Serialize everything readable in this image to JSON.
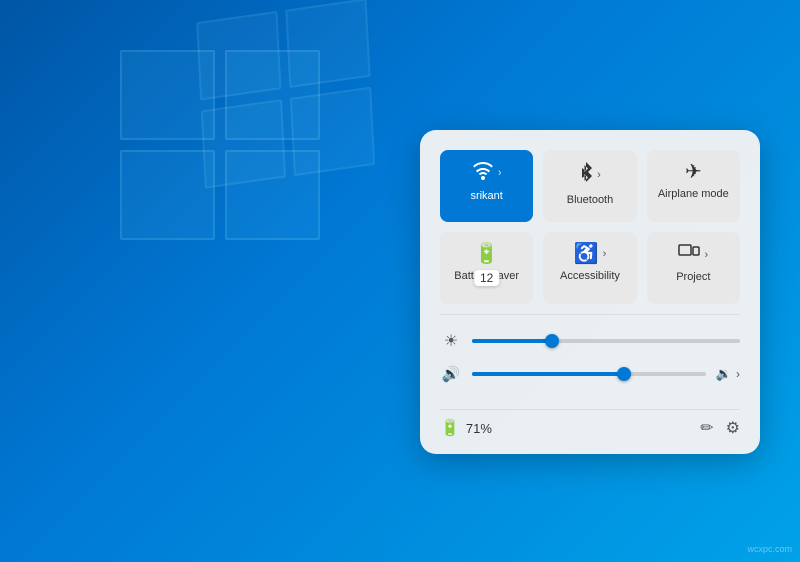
{
  "desktop": {
    "background_start": "#0055a5",
    "background_end": "#00a2e8"
  },
  "quick_panel": {
    "tiles_row1": [
      {
        "id": "wifi",
        "label": "srikant",
        "icon": "wifi",
        "active": true,
        "has_chevron": true
      },
      {
        "id": "bluetooth",
        "label": "Bluetooth",
        "icon": "bluetooth",
        "active": false,
        "has_chevron": true
      },
      {
        "id": "airplane",
        "label": "Airplane mode",
        "icon": "airplane",
        "active": false,
        "has_chevron": false
      }
    ],
    "tiles_row2": [
      {
        "id": "battery-saver",
        "label": "Battery saver",
        "icon": "battery-saver",
        "active": false,
        "has_chevron": false,
        "badge": "12"
      },
      {
        "id": "accessibility",
        "label": "Accessibility",
        "icon": "accessibility",
        "active": false,
        "has_chevron": true
      },
      {
        "id": "project",
        "label": "Project",
        "icon": "project",
        "active": false,
        "has_chevron": true
      }
    ],
    "brightness": {
      "value": 30,
      "icon": "☀",
      "percent": 30
    },
    "volume": {
      "value": 65,
      "icon": "🔊",
      "percent": 65
    },
    "battery": {
      "percent": "71%",
      "icon": "🔋"
    },
    "bottom_icons": {
      "edit": "✏",
      "settings": "⚙"
    }
  },
  "watermark": "wcxpc.com"
}
